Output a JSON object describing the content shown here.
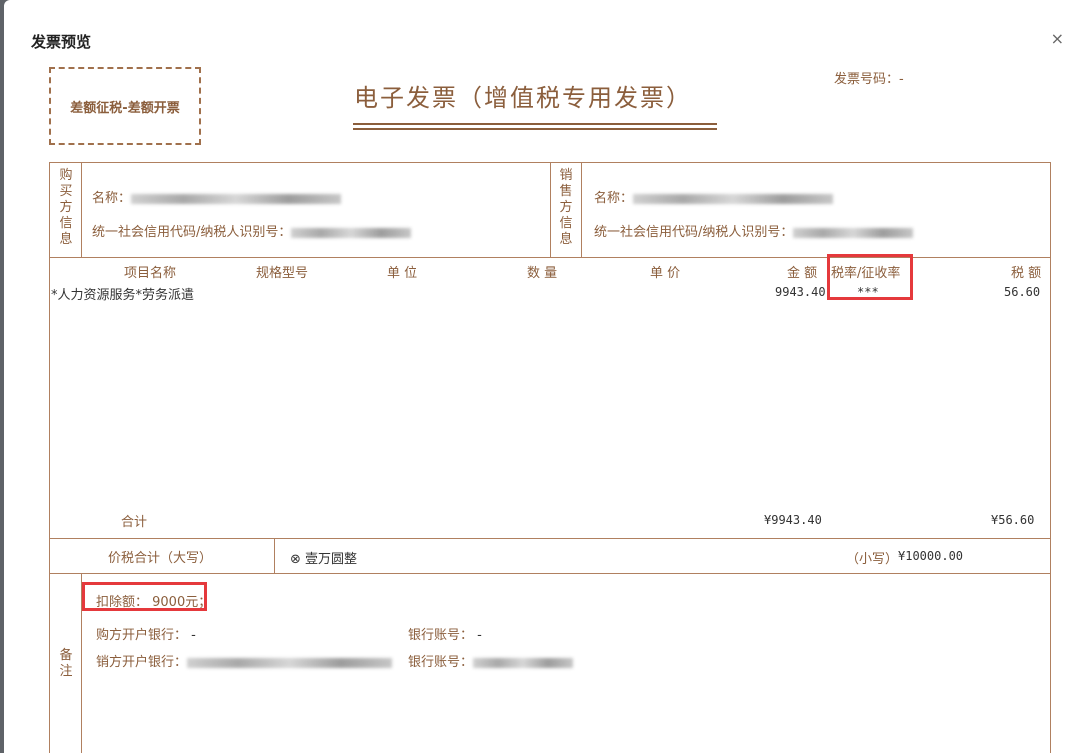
{
  "dialog": {
    "title": "发票预览",
    "close": "×"
  },
  "invoice": {
    "stamp": "差额征税-差额开票",
    "title": "电子发票（增值税专用发票）",
    "number_label": "发票号码：-",
    "buyer": {
      "side_label": [
        "购",
        "买",
        "方",
        "信",
        "息"
      ],
      "name_label": "名称：",
      "tax_id_label": "统一社会信用代码/纳税人识别号："
    },
    "seller": {
      "side_label": [
        "销",
        "售",
        "方",
        "信",
        "息"
      ],
      "name_label": "名称：",
      "tax_id_label": "统一社会信用代码/纳税人识别号："
    },
    "columns": {
      "item": "项目名称",
      "spec": "规格型号",
      "unit": "单 位",
      "qty": "数 量",
      "price": "单 价",
      "amount": "金 额",
      "rate": "税率/征收率",
      "tax": "税 额"
    },
    "items": [
      {
        "name": "*人力资源服务*劳务派遣",
        "amount": "9943.40",
        "rate": "***",
        "tax": "56.60"
      }
    ],
    "subtotal": {
      "label": "合计",
      "amount": "¥9943.40",
      "tax": "¥56.60"
    },
    "total": {
      "label": "价税合计（大写）",
      "symbol": "⊗",
      "words": "壹万圆整",
      "small_label": "（小写）",
      "small_value": "¥10000.00"
    },
    "remarks": {
      "side_label": [
        "备",
        "注"
      ],
      "deduction": "扣除额：  9000元；",
      "buyer_bank_label": "购方开户银行：",
      "buyer_bank_value": "-",
      "buyer_account_label": "银行账号：",
      "buyer_account_value": "-",
      "seller_bank_label": "销方开户银行：",
      "seller_account_label": "银行账号："
    }
  },
  "colors": {
    "invoice_brown": "#8b5e3c",
    "highlight_red": "#e5393c"
  }
}
